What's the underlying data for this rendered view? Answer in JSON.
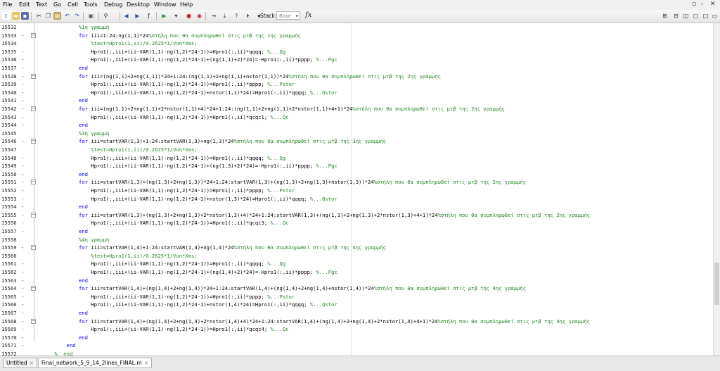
{
  "menu": [
    "File",
    "Edit",
    "Text",
    "Go",
    "Cell",
    "Tools",
    "Debug",
    "Desktop",
    "Window",
    "Help"
  ],
  "toolbar": {
    "stack_label": "Stack:",
    "stack_value": "Base",
    "fx_label": "fx",
    "left_icons": [
      "new-file-icon",
      "open-folder-icon",
      "save-icon",
      "cut-icon",
      "copy-icon",
      "paste-icon",
      "undo-icon",
      "redo-icon",
      "print-icon",
      "find-icon",
      "back-icon",
      "forward-icon",
      "function-icon",
      "run-icon",
      "run-dropdown-icon",
      "breakpoint-icon",
      "clear-breakpoint-icon",
      "step-icon",
      "step-in-icon",
      "step-out-icon",
      "continue-icon",
      "exit-debug-icon"
    ],
    "right_icons": [
      "tile-icon",
      "split-horizontal-icon",
      "split-vertical-icon",
      "float-icon",
      "maximize-icon",
      "minimize-icon"
    ]
  },
  "editor": {
    "lines": [
      {
        "num": "15532",
        "fold": "",
        "parts": [
          {
            "t": "            ",
            "c": ""
          },
          {
            "t": "%1η γραμμή",
            "c": "cm"
          }
        ]
      },
      {
        "num": "15533",
        "fold": "-",
        "parts": [
          {
            "t": "            ",
            "c": ""
          },
          {
            "t": "for",
            "c": "kw"
          },
          {
            "t": " iii=1:24:ng(1,1)*24",
            "c": ""
          },
          {
            "t": "%στήλη που θα συμπληρωθεί στις μτβ της 1ης γραμμής",
            "c": "cm"
          }
        ]
      },
      {
        "num": "15534",
        "fold": "",
        "parts": [
          {
            "t": "                ",
            "c": ""
          },
          {
            "t": "%test=Hpro1(1,ii)/0.2625*1/Von*Xms;",
            "c": "cm"
          }
        ]
      },
      {
        "num": "15535",
        "fold": "-",
        "parts": [
          {
            "t": "                Hpro1(:,iii+(ii-VAR(1,1)-ng(1,2)*24-1))=Hpro1(:,ii)*qqqq; ",
            "c": ""
          },
          {
            "t": "%...Qg",
            "c": "cm"
          }
        ]
      },
      {
        "num": "15536",
        "fold": "-",
        "parts": [
          {
            "t": "                Hpro1(:,iii+(ii-VAR(1,1)-ng(1,2)*24-1)+(ng(1,1)+2)*24)=-Hpro1(:,ii)*pppp; ",
            "c": ""
          },
          {
            "t": "%...Pgc",
            "c": "cm"
          }
        ]
      },
      {
        "num": "15537",
        "fold": "-",
        "parts": [
          {
            "t": "            ",
            "c": ""
          },
          {
            "t": "end",
            "c": "kw"
          }
        ]
      },
      {
        "num": "15538",
        "fold": "-",
        "parts": [
          {
            "t": "            ",
            "c": ""
          },
          {
            "t": "for",
            "c": "kw"
          },
          {
            "t": " iii=(ng(1,1)+2+ng(1,1))*24+1:24:(ng(1,1)+2+ng(1,1)+nstor(1,1))*24",
            "c": ""
          },
          {
            "t": "%στήλη που θα συμπληρωθεί στις μτβ της 2ης γραμμής",
            "c": "cm"
          }
        ]
      },
      {
        "num": "15539",
        "fold": "-",
        "parts": [
          {
            "t": "                Hpro1(:,iii+(ii-VAR(1,1)-ng(1,2)*24-1))=Hpro1(:,ii)*pppp; ",
            "c": ""
          },
          {
            "t": "%...Pstor",
            "c": "cm"
          }
        ]
      },
      {
        "num": "15540",
        "fold": "-",
        "parts": [
          {
            "t": "                Hpro1(:,iii+(ii-VAR(1,1)-ng(1,2)*24-1)+nstor(1,1)*24)=Hpro1(:,ii)*qqqq; ",
            "c": ""
          },
          {
            "t": "%...Qstor",
            "c": "cm"
          }
        ]
      },
      {
        "num": "15541",
        "fold": "-",
        "parts": [
          {
            "t": "            ",
            "c": ""
          },
          {
            "t": "end",
            "c": "kw"
          }
        ]
      },
      {
        "num": "15542",
        "fold": "-",
        "parts": [
          {
            "t": "            ",
            "c": ""
          },
          {
            "t": "for",
            "c": "kw"
          },
          {
            "t": " iii=(ng(1,1)+2+ng(1,1)+2*nstor(1,1)+4)*24+1:24:(ng(1,1)+2+ng(1,1)+2*nstor(1,1)+4+1)*24",
            "c": ""
          },
          {
            "t": "%στήλη που θα συμπληρωθεί στις μτβ της 2ης γραμμής",
            "c": "cm"
          }
        ]
      },
      {
        "num": "15543",
        "fold": "-",
        "parts": [
          {
            "t": "                Hpro1(:,iii+(ii-VAR(1,1)-ng(1,2)*24-1))=Hpro1(:,ii)*qcqc1; ",
            "c": ""
          },
          {
            "t": "%...Qc",
            "c": "cm"
          }
        ]
      },
      {
        "num": "15544",
        "fold": "-",
        "parts": [
          {
            "t": "            ",
            "c": ""
          },
          {
            "t": "end",
            "c": "kw"
          }
        ]
      },
      {
        "num": "15545",
        "fold": "",
        "parts": [
          {
            "t": "            ",
            "c": ""
          },
          {
            "t": "%3η γραμμή",
            "c": "cm"
          }
        ]
      },
      {
        "num": "15546",
        "fold": "-",
        "parts": [
          {
            "t": "            ",
            "c": ""
          },
          {
            "t": "for",
            "c": "kw"
          },
          {
            "t": " iii=startVAR(1,3)+1:24:startVAR(1,3)+ng(1,3)*24",
            "c": ""
          },
          {
            "t": "%στήλη που θα συμπληρωθεί στις μτβ της 3ης γραμμής",
            "c": "cm"
          }
        ]
      },
      {
        "num": "15547",
        "fold": "",
        "parts": [
          {
            "t": "                ",
            "c": ""
          },
          {
            "t": "%test=Hpro1(1,ii)/0.2625*1/Von*Xms;",
            "c": "cm"
          }
        ]
      },
      {
        "num": "15548",
        "fold": "-",
        "parts": [
          {
            "t": "                Hpro1(:,iii+(ii-VAR(1,1)-ng(1,2)*24-1))=Hpro1(:,ii)*qqqq; ",
            "c": ""
          },
          {
            "t": "%...Qg",
            "c": "cm"
          }
        ]
      },
      {
        "num": "15549",
        "fold": "-",
        "parts": [
          {
            "t": "                Hpro1(:,iii+(ii-VAR(1,1)-ng(1,2)*24-1)+(ng(1,3)+2)*24)=-Hpro1(:,ii)*pppp; ",
            "c": ""
          },
          {
            "t": "%...Pgc",
            "c": "cm"
          }
        ]
      },
      {
        "num": "15550",
        "fold": "-",
        "parts": [
          {
            "t": "            ",
            "c": ""
          },
          {
            "t": "end",
            "c": "kw"
          }
        ]
      },
      {
        "num": "15551",
        "fold": "-",
        "parts": [
          {
            "t": "            ",
            "c": ""
          },
          {
            "t": "for",
            "c": "kw"
          },
          {
            "t": " iii=startVAR(1,3)+(ng(1,3)+2+ng(1,3))*24+1:24:startVAR(1,3)+(ng(1,3)+2+ng(1,3)+nstor(1,3))*24",
            "c": ""
          },
          {
            "t": "%στήλη που θα συμπληρωθεί στις μτβ της 2ης γραμμής",
            "c": "cm"
          }
        ]
      },
      {
        "num": "15552",
        "fold": "-",
        "parts": [
          {
            "t": "                Hpro1(:,iii+(ii-VAR(1,1)-ng(1,2)*24-1))=Hpro1(:,ii)*pppp; ",
            "c": ""
          },
          {
            "t": "%...Pstor",
            "c": "cm"
          }
        ]
      },
      {
        "num": "15553",
        "fold": "-",
        "parts": [
          {
            "t": "                Hpro1(:,iii+(ii-VAR(1,1)-ng(1,2)*24-1)+nstor(1,3)*24)=Hpro1(:,ii)*qqqq; ",
            "c": ""
          },
          {
            "t": "%...Qstor",
            "c": "cm"
          }
        ]
      },
      {
        "num": "15554",
        "fold": "-",
        "parts": [
          {
            "t": "            ",
            "c": ""
          },
          {
            "t": "end",
            "c": "kw"
          }
        ]
      },
      {
        "num": "15555",
        "fold": "-",
        "parts": [
          {
            "t": "            ",
            "c": ""
          },
          {
            "t": "for",
            "c": "kw"
          },
          {
            "t": " iii=startVAR(1,3)+(ng(1,3)+2+ng(1,3)+2*nstor(1,3)+4)*24+1:24:startVAR(1,3)+(ng(1,3)+2+ng(1,3)+2*nstor(1,3)+4+1)*24",
            "c": ""
          },
          {
            "t": "%στήλη που θα συμπληρωθεί στις μτβ της 2ης γραμμής",
            "c": "cm"
          }
        ]
      },
      {
        "num": "15556",
        "fold": "-",
        "parts": [
          {
            "t": "                Hpro1(:,iii+(ii-VAR(1,1)-ng(1,2)*24-1))=Hpro1(:,ii)*qcqc3; ",
            "c": ""
          },
          {
            "t": "%...Qc",
            "c": "cm"
          }
        ]
      },
      {
        "num": "15557",
        "fold": "-",
        "parts": [
          {
            "t": "            ",
            "c": ""
          },
          {
            "t": "end",
            "c": "kw"
          }
        ]
      },
      {
        "num": "15558",
        "fold": "",
        "parts": [
          {
            "t": "            ",
            "c": ""
          },
          {
            "t": "%4η γραμμή",
            "c": "cm"
          }
        ]
      },
      {
        "num": "15559",
        "fold": "-",
        "parts": [
          {
            "t": "            ",
            "c": ""
          },
          {
            "t": "for",
            "c": "kw"
          },
          {
            "t": " iii=startVAR(1,4)+1:24:startVAR(1,4)+ng(1,4)*24",
            "c": ""
          },
          {
            "t": "%στήλη που θα συμπληρωθεί στις μτβ της 4ης γραμμής",
            "c": "cm"
          }
        ]
      },
      {
        "num": "15560",
        "fold": "",
        "parts": [
          {
            "t": "                ",
            "c": ""
          },
          {
            "t": "%test=Hpro1(1,ii)/0.2625*1/Von*Xms;",
            "c": "cm"
          }
        ]
      },
      {
        "num": "15561",
        "fold": "-",
        "parts": [
          {
            "t": "                Hpro1(:,iii+(ii-VAR(1,1)-ng(1,2)*24-1))=Hpro1(:,ii)*qqqq; ",
            "c": ""
          },
          {
            "t": "%...Qg",
            "c": "cm"
          }
        ]
      },
      {
        "num": "15562",
        "fold": "-",
        "parts": [
          {
            "t": "                Hpro1(:,iii+(ii-VAR(1,1)-ng(1,2)*24-1)+(ng(1,4)+2)*24)=-Hpro1(:,ii)*pppp; ",
            "c": ""
          },
          {
            "t": "%...Pgc",
            "c": "cm"
          }
        ]
      },
      {
        "num": "15563",
        "fold": "-",
        "parts": [
          {
            "t": "            ",
            "c": ""
          },
          {
            "t": "end",
            "c": "kw"
          }
        ]
      },
      {
        "num": "15564",
        "fold": "-",
        "parts": [
          {
            "t": "            ",
            "c": ""
          },
          {
            "t": "for",
            "c": "kw"
          },
          {
            "t": " iii=startVAR(1,4)+(ng(1,4)+2+ng(1,4))*24+1:24:startVAR(1,4)+(ng(1,4)+2+ng(1,4)+nstor(1,4))*24",
            "c": ""
          },
          {
            "t": "%στήλη που θα συμπληρωθεί στις μτβ της 4ης γραμμής",
            "c": "cm"
          }
        ]
      },
      {
        "num": "15565",
        "fold": "-",
        "parts": [
          {
            "t": "                Hpro1(:,iii+(ii-VAR(1,1)-ng(1,2)*24-1))=Hpro1(:,ii)*pppp; ",
            "c": ""
          },
          {
            "t": "%...Pstor",
            "c": "cm"
          }
        ]
      },
      {
        "num": "15566",
        "fold": "-",
        "parts": [
          {
            "t": "                Hpro1(:,iii+(ii-VAR(1,1)-ng(1,2)*24-1)+nstor(1,4)*24)=Hpro1(:,ii)*qqqq; ",
            "c": ""
          },
          {
            "t": "%...Qstor",
            "c": "cm"
          }
        ]
      },
      {
        "num": "15567",
        "fold": "-",
        "parts": [
          {
            "t": "            ",
            "c": ""
          },
          {
            "t": "end",
            "c": "kw"
          }
        ]
      },
      {
        "num": "15568",
        "fold": "-",
        "parts": [
          {
            "t": "            ",
            "c": ""
          },
          {
            "t": "for",
            "c": "kw"
          },
          {
            "t": " iii=startVAR(1,4)+(ng(1,4)+2+ng(1,4)+2*nstor(1,4)+4)*24+1:24:startVAR(1,4)+(ng(1,4)+2+ng(1,4)+2*nstor(1,4)+4+1)*24",
            "c": ""
          },
          {
            "t": "%στήλη που θα συμπληρωθεί στις μτβ της 4ης γραμμής",
            "c": "cm"
          }
        ]
      },
      {
        "num": "15569",
        "fold": "-",
        "parts": [
          {
            "t": "                Hpro1(:,iii+(ii-VAR(1,1)-ng(1,2)*24-1))=Hpro1(:,ii)*qcqc4; ",
            "c": ""
          },
          {
            "t": "%...Qc",
            "c": "cm"
          }
        ]
      },
      {
        "num": "15570",
        "fold": "-",
        "parts": [
          {
            "t": "            ",
            "c": ""
          },
          {
            "t": "end",
            "c": "kw"
          }
        ]
      },
      {
        "num": "15571",
        "fold": "-",
        "parts": [
          {
            "t": "        ",
            "c": ""
          },
          {
            "t": "end",
            "c": "kw"
          }
        ]
      },
      {
        "num": "15572",
        "fold": "",
        "parts": [
          {
            "t": "    ",
            "c": ""
          },
          {
            "t": "%  end",
            "c": "cm"
          }
        ]
      }
    ]
  },
  "tabs": [
    {
      "label": "Untitled",
      "active": false
    },
    {
      "label": "Final_network_5_9_14_2lines_FINAL.m",
      "active": true
    }
  ],
  "colors": {
    "keyword": "#0000ff",
    "comment": "#228b22",
    "text": "#000000"
  }
}
